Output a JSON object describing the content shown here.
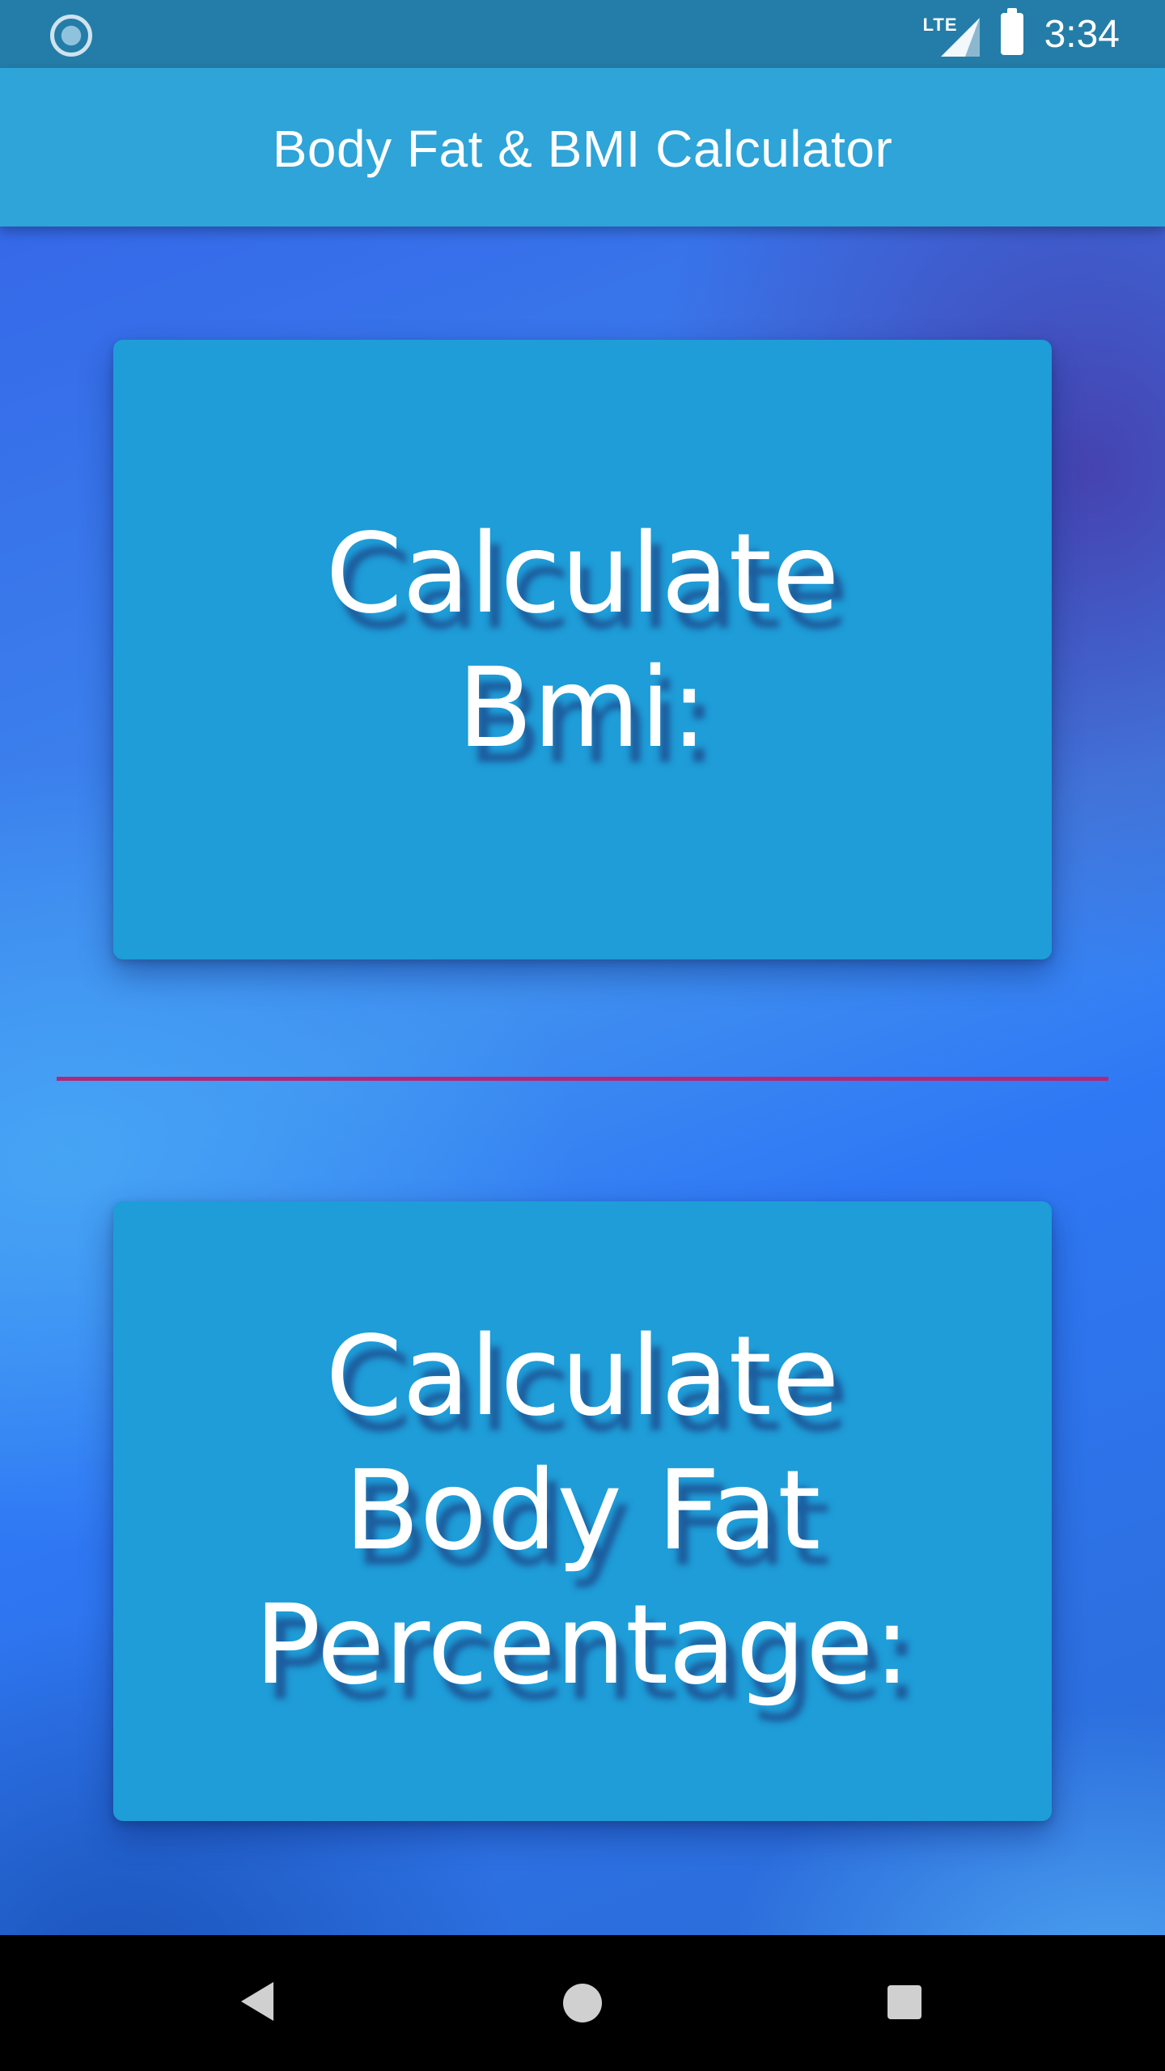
{
  "status_bar": {
    "left_icon": "sync-indicator-icon",
    "network_label": "LTE",
    "signal_icon": "cell-signal-icon",
    "battery_icon": "battery-full-icon",
    "time": "3:34"
  },
  "app_bar": {
    "title": "Body Fat & BMI Calculator"
  },
  "main": {
    "bmi_button_label": "Calculate Bmi:",
    "body_fat_button_label": "Calculate Body Fat Percentage:"
  },
  "nav_bar": {
    "back_icon": "back-triangle-icon",
    "home_icon": "home-circle-icon",
    "recents_icon": "recents-square-icon"
  },
  "colors": {
    "status_bar": "#237da8",
    "app_bar": "#2ea4d8",
    "card": "#1e9dd8",
    "divider": "#b0287a",
    "background_primary": "#3f8ff0"
  }
}
